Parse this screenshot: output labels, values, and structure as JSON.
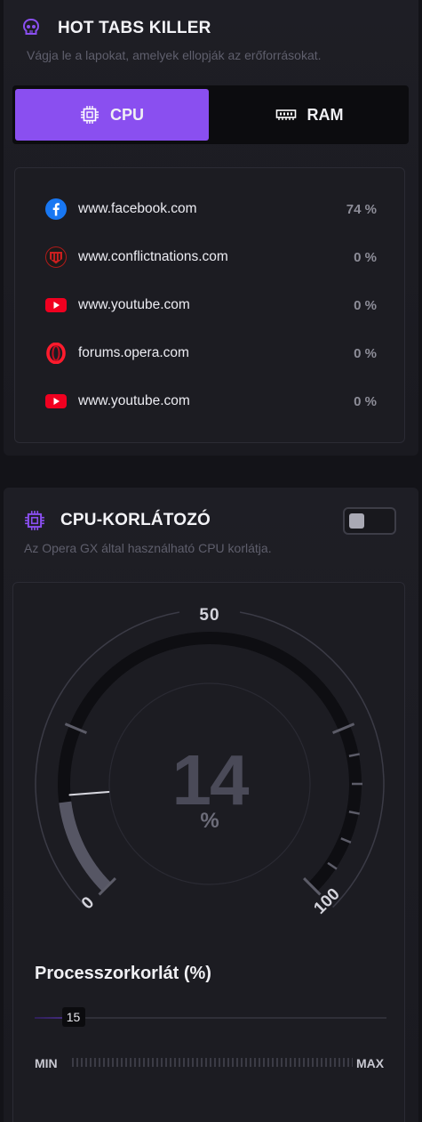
{
  "hot_tabs": {
    "title": "HOT TABS KILLER",
    "subtitle": "Vágja le a lapokat, amelyek ellopják az erőforrásokat.",
    "icon": "skull-icon",
    "tabs": [
      {
        "label": "CPU",
        "icon": "cpu-icon",
        "active": true
      },
      {
        "label": "RAM",
        "icon": "ram-icon",
        "active": false
      }
    ],
    "rows": [
      {
        "site": "www.facebook.com",
        "value": "74 %",
        "favicon": "facebook-icon"
      },
      {
        "site": "www.conflictnations.com",
        "value": "0 %",
        "favicon": "conflictnations-icon"
      },
      {
        "site": "www.youtube.com",
        "value": "0 %",
        "favicon": "youtube-icon"
      },
      {
        "site": "forums.opera.com",
        "value": "0 %",
        "favicon": "opera-icon"
      },
      {
        "site": "www.youtube.com",
        "value": "0 %",
        "favicon": "youtube-icon"
      }
    ]
  },
  "limiter": {
    "title": "CPU-KORLÁTOZÓ",
    "subtitle": "Az Opera GX által használható CPU korlátja.",
    "icon": "cpu-icon",
    "toggle_on": false,
    "gauge": {
      "value": "14",
      "value_num": 14,
      "unit": "%",
      "label_min": "0",
      "label_mid": "50",
      "label_max": "100",
      "limit_value": 15
    },
    "slider": {
      "title": "Processzorkorlát (%)",
      "value": "15",
      "fraction": 0.11,
      "min_label": "MIN",
      "max_label": "MAX"
    }
  },
  "colors": {
    "accent": "#8a4ff0",
    "panel": "#1e1e25",
    "youtube": "#f00020",
    "facebook": "#1877f2",
    "opera": "#ff1b2d"
  }
}
